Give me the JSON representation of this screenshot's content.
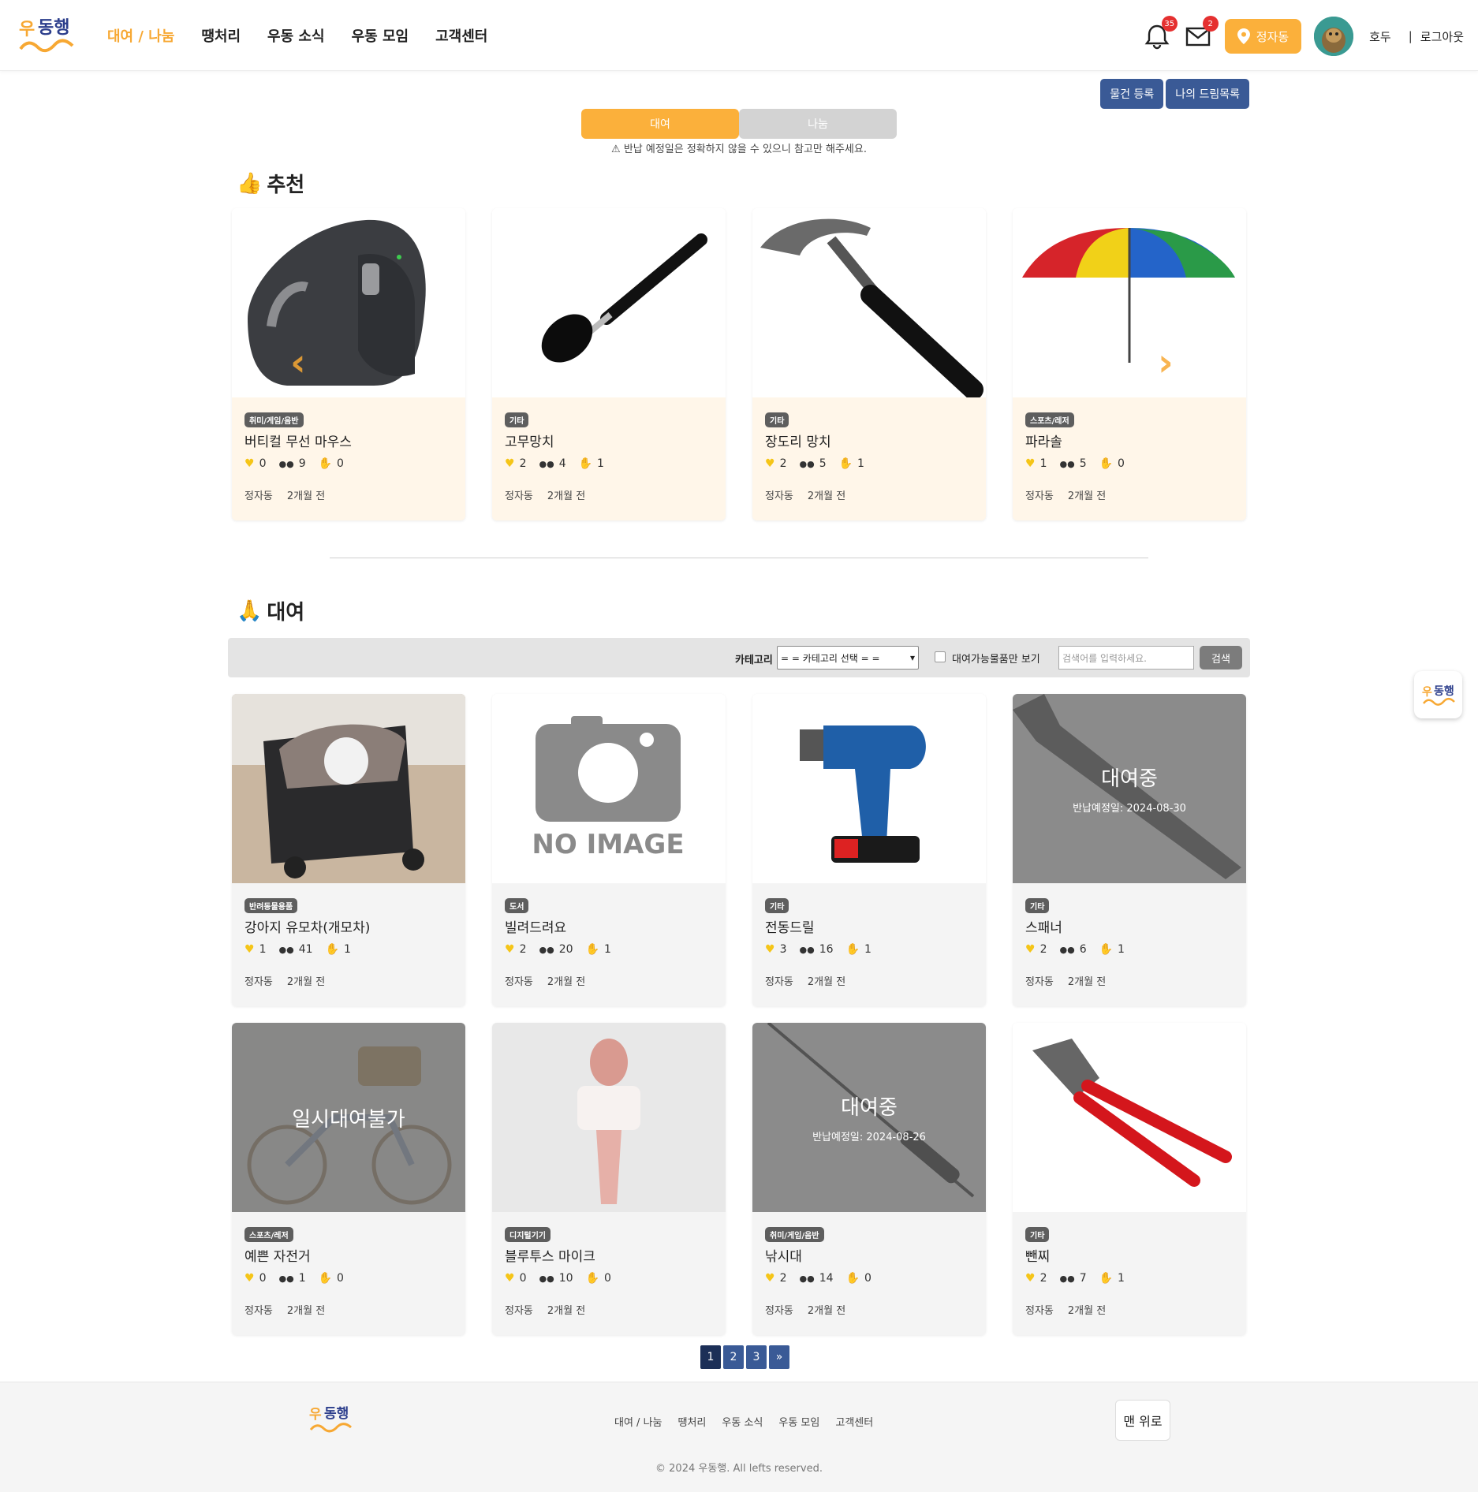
{
  "header": {
    "nav": [
      "대여 / 나눔",
      "땡처리",
      "우동 소식",
      "우동 모임",
      "고객센터"
    ],
    "notif_count": "35",
    "mail_count": "2",
    "location": "정자동",
    "username": "호두",
    "separator": "|",
    "logout": "로그아웃"
  },
  "actions": {
    "register": "물건 등록",
    "dreamlist": "나의 드림목록"
  },
  "toggle": {
    "rent": "대여",
    "share": "나눔"
  },
  "notice": "⚠ 반납 예정일은 정확하지 않을 수 있으니 참고만 해주세요.",
  "sections": {
    "recommend": "추천",
    "rent": "대여",
    "recommend_emoji": "👍",
    "rent_emoji": "🙏"
  },
  "search": {
    "category_label": "카테고리",
    "category_value": "= = 카테고리 선택 = =",
    "available_only": "대여가능물품만 보기",
    "placeholder": "검색어를 입력하세요.",
    "button": "검색"
  },
  "recommended": [
    {
      "cat": "취미/게임/음반",
      "title": "버티컬 무선 마우스",
      "likes": "0",
      "views": "9",
      "chats": "0",
      "loc": "정자동",
      "time": "2개월 전"
    },
    {
      "cat": "기타",
      "title": "고무망치",
      "likes": "2",
      "views": "4",
      "chats": "1",
      "loc": "정자동",
      "time": "2개월 전"
    },
    {
      "cat": "기타",
      "title": "장도리 망치",
      "likes": "2",
      "views": "5",
      "chats": "1",
      "loc": "정자동",
      "time": "2개월 전"
    },
    {
      "cat": "스포츠/레저",
      "title": "파라솔",
      "likes": "1",
      "views": "5",
      "chats": "0",
      "loc": "정자동",
      "time": "2개월 전"
    }
  ],
  "rentals": [
    {
      "cat": "반려동물용품",
      "title": "강아지 유모차(개모차)",
      "likes": "1",
      "views": "41",
      "chats": "1",
      "loc": "정자동",
      "time": "2개월 전"
    },
    {
      "cat": "도서",
      "title": "빌려드려요",
      "likes": "2",
      "views": "20",
      "chats": "1",
      "loc": "정자동",
      "time": "2개월 전",
      "noimage": "NO IMAGE"
    },
    {
      "cat": "기타",
      "title": "전동드릴",
      "likes": "3",
      "views": "16",
      "chats": "1",
      "loc": "정자동",
      "time": "2개월 전"
    },
    {
      "cat": "기타",
      "title": "스패너",
      "likes": "2",
      "views": "6",
      "chats": "1",
      "loc": "정자동",
      "time": "2개월 전",
      "status": "대여중",
      "due": "반납예정일: 2024-08-30"
    },
    {
      "cat": "스포츠/레저",
      "title": "예쁜 자전거",
      "likes": "0",
      "views": "1",
      "chats": "0",
      "loc": "정자동",
      "time": "2개월 전",
      "status": "일시대여불가"
    },
    {
      "cat": "디지털기기",
      "title": "블루투스 마이크",
      "likes": "0",
      "views": "10",
      "chats": "0",
      "loc": "정자동",
      "time": "2개월 전"
    },
    {
      "cat": "취미/게임/음반",
      "title": "낚시대",
      "likes": "2",
      "views": "14",
      "chats": "0",
      "loc": "정자동",
      "time": "2개월 전",
      "status": "대여중",
      "due": "반납예정일: 2024-08-26"
    },
    {
      "cat": "기타",
      "title": "뺀찌",
      "likes": "2",
      "views": "7",
      "chats": "1",
      "loc": "정자동",
      "time": "2개월 전"
    }
  ],
  "pagination": [
    "1",
    "2",
    "3",
    "»"
  ],
  "footer": {
    "nav": [
      "대여 / 나눔",
      "땡처리",
      "우동 소식",
      "우동 모임",
      "고객센터"
    ],
    "top_button": "맨 위로",
    "copyright": "© 2024 우동행. All lefts reserved."
  },
  "icons": {
    "like": "heart-icon",
    "view": "eyes-icon",
    "chat": "hand-icon"
  },
  "colors": {
    "accent": "#f7a833",
    "navy": "#3a5a96",
    "rec_card": "#fff6e9"
  }
}
